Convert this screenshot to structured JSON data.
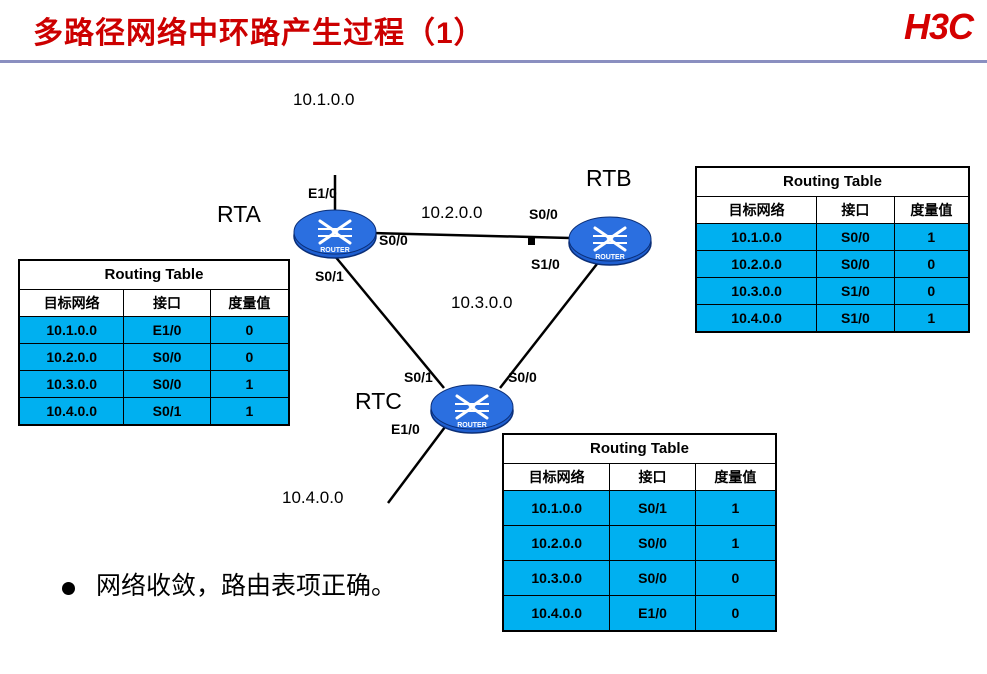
{
  "header": {
    "title": "多路径网络中环路产生过程（1）",
    "logo": "H3C"
  },
  "diagram": {
    "routers": [
      {
        "name": "RTA",
        "badge": "ROUTER"
      },
      {
        "name": "RTB",
        "badge": "ROUTER"
      },
      {
        "name": "RTC",
        "badge": "ROUTER"
      }
    ],
    "networks": {
      "top": "10.1.0.0",
      "ab_link": "10.2.0.0",
      "bc_link": "10.3.0.0",
      "bottom": "10.4.0.0"
    },
    "interfaces": {
      "rta_e1_0": "E1/0",
      "rta_s0_0": "S0/0",
      "rta_s0_1": "S0/1",
      "rtb_s0_0": "S0/0",
      "rtb_s1_0": "S1/0",
      "rtc_s0_1": "S0/1",
      "rtc_s0_0": "S0/0",
      "rtc_e1_0": "E1/0"
    }
  },
  "tables": {
    "caption": "Routing Table",
    "headers": [
      "目标网络",
      "接口",
      "度量值"
    ],
    "rta": {
      "rows": [
        [
          "10.1.0.0",
          "E1/0",
          "0"
        ],
        [
          "10.2.0.0",
          "S0/0",
          "0"
        ],
        [
          "10.3.0.0",
          "S0/0",
          "1"
        ],
        [
          "10.4.0.0",
          "S0/1",
          "1"
        ]
      ]
    },
    "rtb": {
      "rows": [
        [
          "10.1.0.0",
          "S0/0",
          "1"
        ],
        [
          "10.2.0.0",
          "S0/0",
          "0"
        ],
        [
          "10.3.0.0",
          "S1/0",
          "0"
        ],
        [
          "10.4.0.0",
          "S1/0",
          "1"
        ]
      ]
    },
    "rtc": {
      "rows": [
        [
          "10.1.0.0",
          "S0/1",
          "1"
        ],
        [
          "10.2.0.0",
          "S0/0",
          "1"
        ],
        [
          "10.3.0.0",
          "S0/0",
          "0"
        ],
        [
          "10.4.0.0",
          "E1/0",
          "0"
        ]
      ]
    }
  },
  "bullet": {
    "text": "网络收敛，路由表项正确。"
  }
}
